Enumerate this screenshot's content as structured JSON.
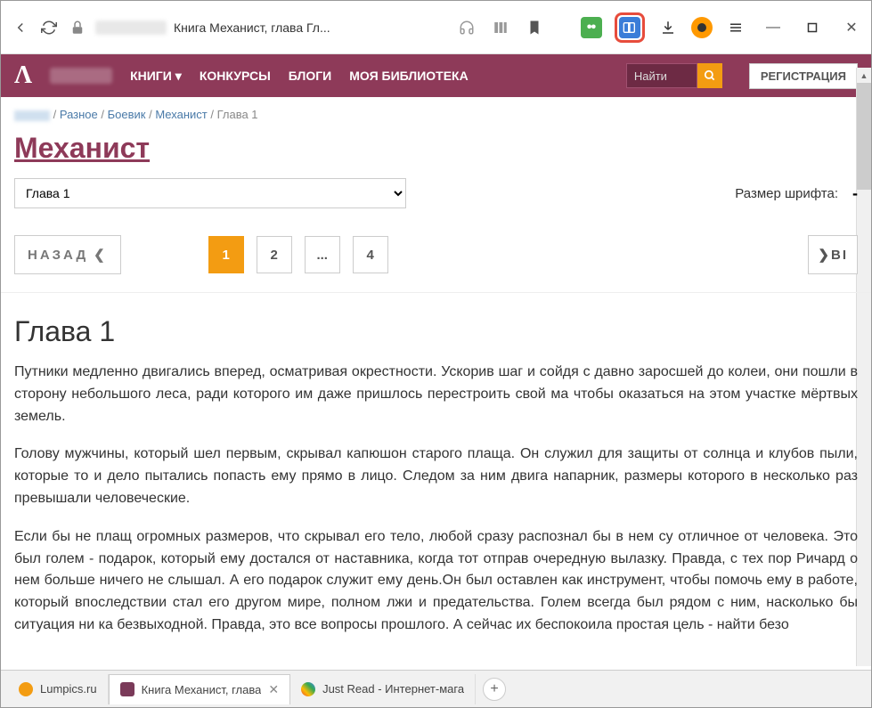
{
  "browser": {
    "page_title": "Книга Механист, глава Гл...",
    "tabs": [
      {
        "title": "Lumpics.ru",
        "favicon": "#f39c12"
      },
      {
        "title": "Книга Механист, глава",
        "favicon": "#7a3a59"
      },
      {
        "title": "Just Read - Интернет-мага",
        "favicon": "#4285f4"
      }
    ]
  },
  "header": {
    "nav": {
      "books": "КНИГИ",
      "contests": "КОНКУРСЫ",
      "blogs": "БЛОГИ",
      "library": "МОЯ БИБЛИОТЕКА"
    },
    "search_placeholder": "Найти",
    "register": "РЕГИСТРАЦИЯ"
  },
  "breadcrumb": {
    "items": [
      "Разное",
      "Боевик",
      "Механист"
    ],
    "current": "Глава 1"
  },
  "book": {
    "title": "Механист",
    "chapter_select": "Глава 1",
    "font_size_label": "Размер шрифта:"
  },
  "pagination": {
    "back": "НАЗАД",
    "forward": "ВІ",
    "pages": [
      "1",
      "2",
      "...",
      "4"
    ],
    "active_index": 0
  },
  "chapter": {
    "heading": "Глава 1",
    "paragraphs": [
      "Путники медленно двигались вперед, осматривая окрестности.  Ускорив шаг и сойдя с давно заросшей до колеи, они пошли в сторону небольшого леса, ради которого им даже пришлось перестроить свой ма чтобы оказаться на этом участке мёртвых земель.",
      "Голову мужчины, который шел первым, скрывал капюшон старого плаща. Он служил для защиты от солнца и клубов пыли, которые то и дело пытались попасть ему прямо в лицо. Следом за ним двига напарник, размеры которого в несколько раз превышали человеческие.",
      "Если бы не плащ огромных размеров, что скрывал его тело, любой сразу распознал бы в нем су отличное от человека. Это был голем - подарок, который ему достался от наставника, когда тот отправ очередную вылазку. Правда, с тех пор Ричард о нем больше ничего не слышал. А его подарок служит ему день.Он был оставлен как инструмент, чтобы помочь ему в работе, который впоследствии стал его другом мире, полном лжи и предательства. Голем всегда был рядом с ним, насколько бы ситуация ни ка безвыходной. Правда, это все вопросы прошлого. А сейчас их беспокоила простая цель - найти безо"
    ]
  }
}
